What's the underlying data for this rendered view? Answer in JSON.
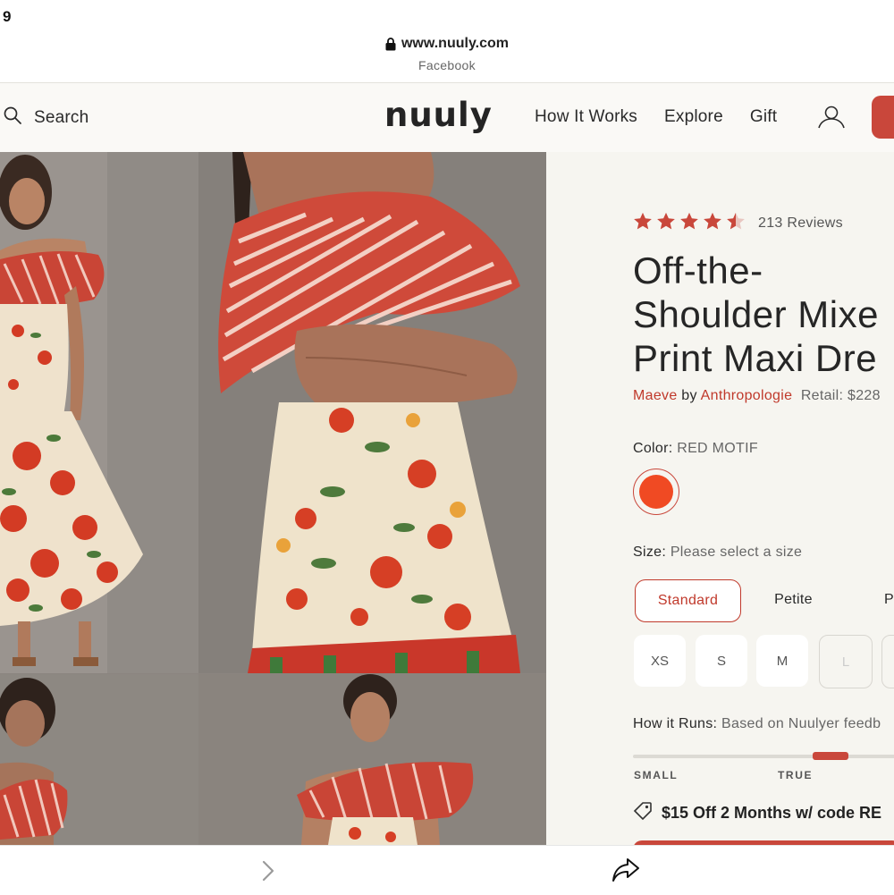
{
  "status_bar": {
    "time": "9"
  },
  "browser": {
    "url": "www.nuuly.com",
    "source": "Facebook"
  },
  "header": {
    "search_label": "Search",
    "logo": "nuuly",
    "nav": [
      "How It Works",
      "Explore",
      "Gift"
    ]
  },
  "product": {
    "rating": 4.5,
    "reviews": "213 Reviews",
    "title_lines": [
      "Off-the-",
      "Shoulder Mixe",
      "Print Maxi Dre"
    ],
    "brand": "Maeve",
    "by": "by",
    "designer": "Anthropologie",
    "retail": "Retail: $228",
    "color_label": "Color:",
    "color_value": "RED MOTIF",
    "size_label": "Size:",
    "size_value": "Please select a size",
    "fit_tabs": [
      "Standard",
      "Petite",
      "P"
    ],
    "sizes": [
      "XS",
      "S",
      "M",
      "L"
    ],
    "runs_label": "How it Runs:",
    "runs_value": "Based on Nuulyer feedb",
    "runs_scale": [
      "SMALL",
      "TRUE"
    ],
    "promo": "$15 Off 2 Months w/ code RE"
  },
  "colors": {
    "accent": "#c0392b",
    "swatch": "#f04a23",
    "panel_bg": "#f6f5f0"
  },
  "icons": [
    "lock-icon",
    "search-icon",
    "account-icon",
    "star-icon",
    "tag-icon",
    "chevron-right-icon",
    "share-icon"
  ]
}
